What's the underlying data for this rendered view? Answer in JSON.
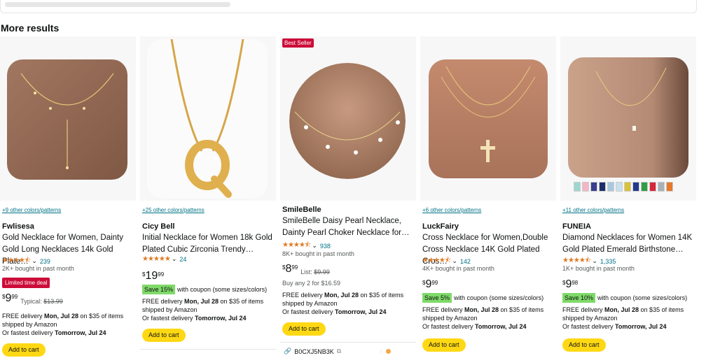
{
  "section_title": "More results",
  "products": [
    {
      "colors_link": "+9 other colors/patterns",
      "brand": "Fwlisesa",
      "title_line1": "Gold Necklace for Women, Dainty",
      "title_line2": "Gold Long Necklaces 14k Gold Plate…",
      "stars": "★★★★⯪",
      "rating_value": 4.4,
      "rating_count": "239",
      "bought": "2K+ bought in past month",
      "deal_badge": "Limited time deal",
      "price_symbol": "$",
      "price_whole": "9",
      "price_cents": "99",
      "typical_label": "Typical:",
      "typical_price": "$13.99",
      "delivery_prefix": "FREE delivery ",
      "delivery_date": "Mon, Jul 28",
      "delivery_suffix": " on $35 of items",
      "shipped": "shipped by Amazon",
      "fastest_prefix": "Or fastest delivery ",
      "fastest_date": "Tomorrow, Jul 24",
      "add_to_cart": "Add to cart"
    },
    {
      "colors_link": "+25 other colors/patterns",
      "brand": "Cicy Bell",
      "title_line1": "Initial Necklace for Women 18k Gold",
      "title_line2": "Plated Cubic Zirconia Trendy…",
      "stars": "★★★★★",
      "rating_value": 4.8,
      "rating_count": "24",
      "price_symbol": "$",
      "price_whole": "19",
      "price_cents": "99",
      "coupon_save": "Save 15%",
      "coupon_text": "with coupon (some sizes/colors)",
      "delivery_prefix": "FREE delivery ",
      "delivery_date": "Mon, Jul 28",
      "delivery_suffix": " on $35 of items",
      "shipped": "shipped by Amazon",
      "fastest_prefix": "Or fastest delivery ",
      "fastest_date": "Tomorrow, Jul 24",
      "add_to_cart": "Add to cart"
    },
    {
      "best_seller": "Best Seller",
      "brand": "SmileBelle",
      "title_line1": "SmileBelle Daisy Pearl Necklace,",
      "title_line2": "Dainty Pearl Choker Necklace for…",
      "stars": "★★★★⯪",
      "rating_value": 4.5,
      "rating_count": "938",
      "bought": "8K+ bought in past month",
      "price_symbol": "$",
      "price_whole": "8",
      "price_cents": "99",
      "list_label": "List:",
      "list_price": "$9.99",
      "buy_any": "Buy any 2 for $16.59",
      "delivery_prefix": "FREE delivery ",
      "delivery_date": "Mon, Jul 28",
      "delivery_suffix": " on $35 of items",
      "shipped": "shipped by Amazon",
      "fastest_prefix": "Or fastest delivery ",
      "fastest_date": "Tomorrow, Jul 24",
      "add_to_cart": "Add to cart",
      "asin": "B0CXJ5NB3K"
    },
    {
      "colors_link": "+6 other colors/patterns",
      "brand": "LuckFairy",
      "title_line1": "Cross Necklace for Women,Double",
      "title_line2": "Cross Necklace 14K Gold Plated Cros…",
      "stars": "★★★★⯪",
      "rating_value": 4.4,
      "rating_count": "142",
      "bought": "4K+ bought in past month",
      "price_symbol": "$",
      "price_whole": "9",
      "price_cents": "99",
      "coupon_save": "Save 5%",
      "coupon_text": "with coupon (some sizes/colors)",
      "delivery_prefix": "FREE delivery ",
      "delivery_date": "Mon, Jul 28",
      "delivery_suffix": " on $35 of items",
      "shipped": "shipped by Amazon",
      "fastest_prefix": "Or fastest delivery ",
      "fastest_date": "Tomorrow, Jul 24",
      "add_to_cart": "Add to cart"
    },
    {
      "colors_link": "+11 other colors/patterns",
      "brand": "FUNEIA",
      "title_line1": "Diamond Necklaces for Women 14K",
      "title_line2": "Gold Plated Emerald Birthstone…",
      "stars": "★★★★⯪",
      "rating_value": 4.4,
      "rating_count": "1,335",
      "bought": "1K+ bought in past month",
      "price_symbol": "$",
      "price_whole": "9",
      "price_cents": "98",
      "coupon_save": "Save 10%",
      "coupon_text": "with coupon (some sizes/colors)",
      "delivery_prefix": "FREE delivery ",
      "delivery_date": "Mon, Jul 28",
      "delivery_suffix": " on $35 of items",
      "shipped": "shipped by Amazon",
      "fastest_prefix": "Or fastest delivery ",
      "fastest_date": "Tomorrow, Jul 24",
      "add_to_cart": "Add to cart",
      "swatch_colors": [
        "#9fd6d0",
        "#f2b6c6",
        "#3a3f8f",
        "#1c2f6b",
        "#a9c8de",
        "#c8e0ef",
        "#d8c23a",
        "#233a8a",
        "#2f9e44",
        "#d62839",
        "#a9b0b7",
        "#e7792b"
      ]
    }
  ],
  "colors": {
    "accent_link": "#007185",
    "button_yellow": "#ffd814",
    "deal_red": "#cc0c39",
    "save_green": "#7fda69",
    "star_orange": "#de7921"
  }
}
